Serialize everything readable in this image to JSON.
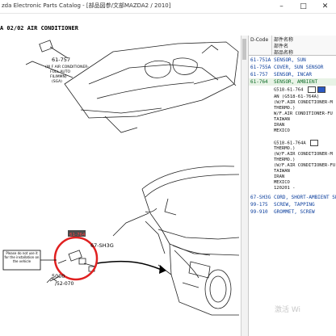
{
  "window": {
    "title": "zda Electronic Parts Catalog - [部品図参/文部MAZDA2 / 2010]"
  },
  "section_header": "A 02/02 AIR CONDITIONER",
  "illustration": {
    "labels": {
      "top_part_no": "61-757",
      "top_part_note_1": "(W F AIR CONDITIONER-",
      "top_part_note_2": "FULL AUTO",
      "top_part_note_3": "FILIMMN)",
      "top_part_note_4": "(SGA)",
      "lower_part_no": "61-764",
      "lower_part_no_2": "67-SH3G",
      "lower_part_no_3": "5000",
      "lower_part_no_4": "/52-070",
      "notice": "Please do not use it for the installation on the vehicle"
    }
  },
  "parts_panel": {
    "col_code": "D-Code",
    "col_desc_line1": "部件名称",
    "col_desc_line2": "部件名",
    "col_desc_line3": "部品名称",
    "rows": [
      {
        "no": "61-751A",
        "desc": "SENSOR, SUN",
        "selected": false
      },
      {
        "no": "61-755A",
        "desc": "COVER, SUN SENSOR",
        "selected": false
      },
      {
        "no": "61-757",
        "desc": "SENSOR, INCAR",
        "selected": false
      },
      {
        "no": "61-764",
        "desc": "SENSOR, AMBIENT",
        "selected": true
      }
    ],
    "detail_1": {
      "code": "G518-61-764",
      "lines": [
        "AN  (G518-61-764A)",
        "(W/F.AIR CONDITIONER-M",
        "THERMO.)",
        "W/F.AIR CONDITIONER-FU",
        "TAIWAN",
        "IRAN",
        "MEXICO"
      ]
    },
    "detail_2": {
      "code": "G518-61-764A",
      "lines": [
        "THERMO.)",
        "(W/F.AIR CONDITIONER-M",
        "THERMO.)",
        "(W/F.AIR CONDITIONER-FU",
        "TAIWAN",
        "IRAN",
        "MEXICO",
        "120201  -"
      ]
    },
    "rows_bottom": [
      {
        "no": "67-SH3G",
        "desc": "CORD, SHORT-AMBIENT SEN"
      },
      {
        "no": "99-175",
        "desc": "SCREW, TAPPING"
      },
      {
        "no": "99-910",
        "desc": "GROMMET, SCREW"
      }
    ]
  },
  "watermark": "激活 Wi",
  "colors": {
    "selected_row_text": "#0b6b25",
    "link_text": "#0a3d9c",
    "highlight_circle": "#e02020"
  }
}
